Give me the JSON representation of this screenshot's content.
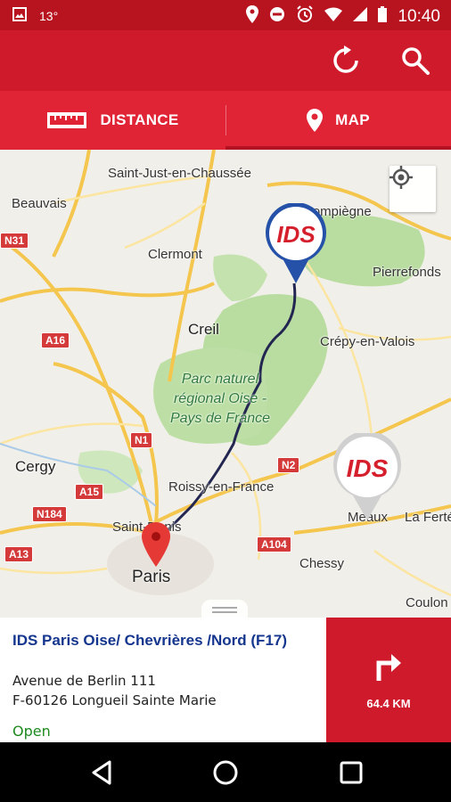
{
  "statusbar": {
    "temperature": "13°",
    "time": "10:40"
  },
  "tabs": [
    {
      "label": "DISTANCE",
      "active": false
    },
    {
      "label": "MAP",
      "active": true
    }
  ],
  "map": {
    "labels": {
      "saint_just": "Saint-Just-en-Chaussée",
      "beauvais": "Beauvais",
      "compiegne": "Compiègne",
      "clermont": "Clermont",
      "pierrefonds": "Pierrefonds",
      "creil": "Creil",
      "crepy": "Crépy-en-Valois",
      "park": "Parc naturel régional Oise - Pays de France",
      "cergy": "Cergy",
      "roissy": "Roissy-en-France",
      "saint_denis": "Saint-Denis",
      "meaux": "Meaux",
      "la_ferte": "La Ferté",
      "paris": "Paris",
      "chessy": "Chessy",
      "coulon": "Coulon"
    },
    "shields": {
      "n31": "N31",
      "a16": "A16",
      "n1": "N1",
      "n2": "N2",
      "a15": "A15",
      "n184": "N184",
      "a13": "A13",
      "a104": "A104"
    },
    "marker_logo": "IDS"
  },
  "station": {
    "name": "IDS Paris Oise/ Chevrières /Nord (F17)",
    "address_line1": "Avenue de Berlin 111",
    "address_line2": "F-60126 Longueil Sainte Marie",
    "status": "Open"
  },
  "navigation": {
    "distance": "64.4 KM"
  },
  "colors": {
    "brand": "#cf1a2b",
    "title": "#15368e",
    "open": "#1e8a1e"
  }
}
